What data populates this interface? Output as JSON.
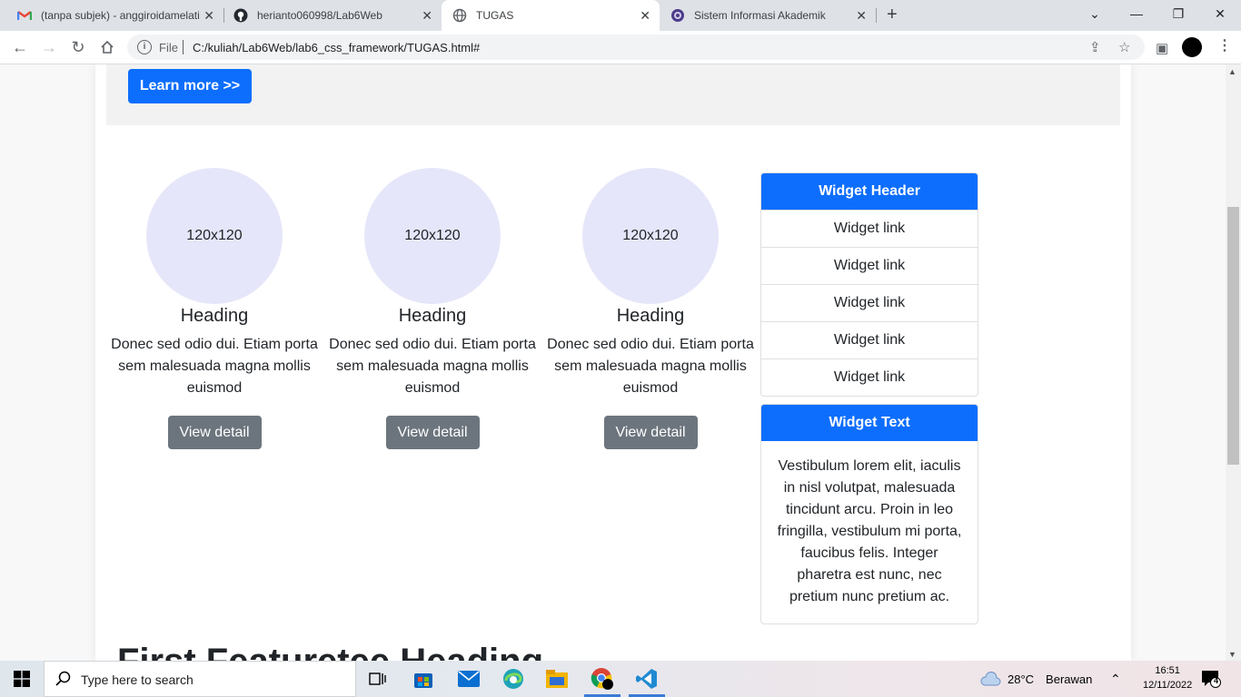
{
  "browser": {
    "tabs": [
      {
        "title": "(tanpa subjek) - anggiroidamelati",
        "icon": "gmail-icon",
        "active": false
      },
      {
        "title": "herianto060998/Lab6Web",
        "icon": "github-icon",
        "active": false
      },
      {
        "title": "TUGAS",
        "icon": "globe-icon",
        "active": true
      },
      {
        "title": "Sistem Informasi Akademik",
        "icon": "university-icon",
        "active": false
      }
    ],
    "address": {
      "scheme_label": "File",
      "url": "C:/kuliah/Lab6Web/lab6_css_framework/TUGAS.html#"
    }
  },
  "page": {
    "jumbotron": {
      "button_label": "Learn more >>"
    },
    "cards": [
      {
        "image_label": "120x120",
        "heading": "Heading",
        "text": "Donec sed odio dui. Etiam porta sem malesuada magna mollis euismod",
        "button_label": "View detail"
      },
      {
        "image_label": "120x120",
        "heading": "Heading",
        "text": "Donec sed odio dui. Etiam porta sem malesuada magna mollis euismod",
        "button_label": "View detail"
      },
      {
        "image_label": "120x120",
        "heading": "Heading",
        "text": "Donec sed odio dui. Etiam porta sem malesuada magna mollis euismod",
        "button_label": "View detail"
      }
    ],
    "widget_links": {
      "header": "Widget Header",
      "links": [
        "Widget link",
        "Widget link",
        "Widget link",
        "Widget link",
        "Widget link"
      ]
    },
    "widget_text": {
      "header": "Widget Text",
      "body": "Vestibulum lorem elit, iaculis in nisl volutpat, malesuada tincidunt arcu. Proin in leo fringilla, vestibulum mi porta, faucibus felis. Integer pharetra est nunc, nec pretium nunc pretium ac."
    },
    "feature_heading": "First Featuretee Heading"
  },
  "taskbar": {
    "search_placeholder": "Type here to search",
    "weather": {
      "temp": "28°C",
      "condition": "Berawan"
    },
    "clock": {
      "time": "16:51",
      "date": "12/11/2022"
    },
    "notification_count": "4"
  },
  "colors": {
    "primary": "#0d6efd",
    "secondary": "#6c757d",
    "placeholder": "#e6e6fa"
  }
}
